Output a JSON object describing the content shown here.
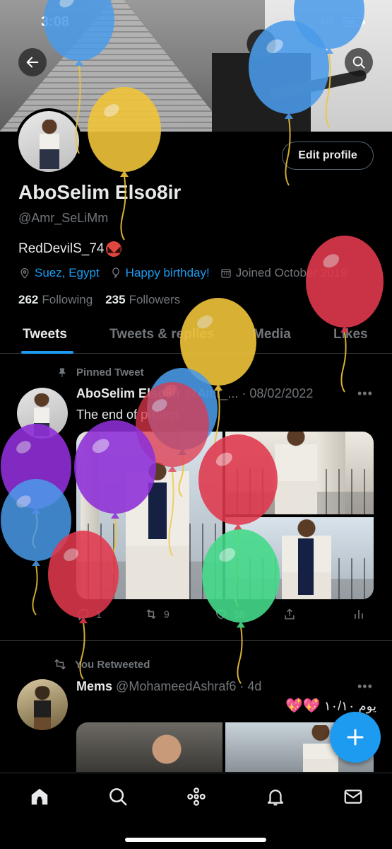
{
  "status_bar": {
    "time": "3:08",
    "network": "4G"
  },
  "profile": {
    "display_name": "AboSelim Elso8ir",
    "handle": "@Amr_SeLiMm",
    "bio": "RedDevilS_74",
    "location": "Suez, Egypt",
    "birthday_text": "Happy birthday!",
    "joined": "Joined October 2019",
    "following_count": "262",
    "following_label": "Following",
    "followers_count": "235",
    "followers_label": "Followers",
    "edit_label": "Edit profile"
  },
  "tabs": [
    "Tweets",
    "Tweets & replies",
    "Media",
    "Likes"
  ],
  "pinned_tweet": {
    "pinned_label": "Pinned Tweet",
    "author": "AboSelim Elso8ir",
    "handle": "@Amr_...",
    "date": "· 08/02/2022",
    "text": "The end of project",
    "replies": "1",
    "retweets": "9",
    "likes": "58"
  },
  "retweeted_tweet": {
    "retweet_label": "You Retweeted",
    "author": "Mems",
    "handle": "@MohameedAshraf6",
    "time": "· 4d",
    "text": "يوم ١٠/١٠"
  },
  "icons": {
    "back": "arrow-left-icon",
    "search": "search-icon",
    "compose": "plus-icon",
    "nav": [
      "home-icon",
      "search-icon",
      "spaces-icon",
      "bell-icon",
      "mail-icon"
    ]
  },
  "colors": {
    "accent": "#1d9bf0",
    "background": "#000000",
    "secondary_text": "#71767b"
  },
  "balloon_colors": {
    "blue": "#4a9bea",
    "yellow": "#f0c43a",
    "red": "#e0384d",
    "purple": "#8f2fd8",
    "green": "#45d98a"
  }
}
